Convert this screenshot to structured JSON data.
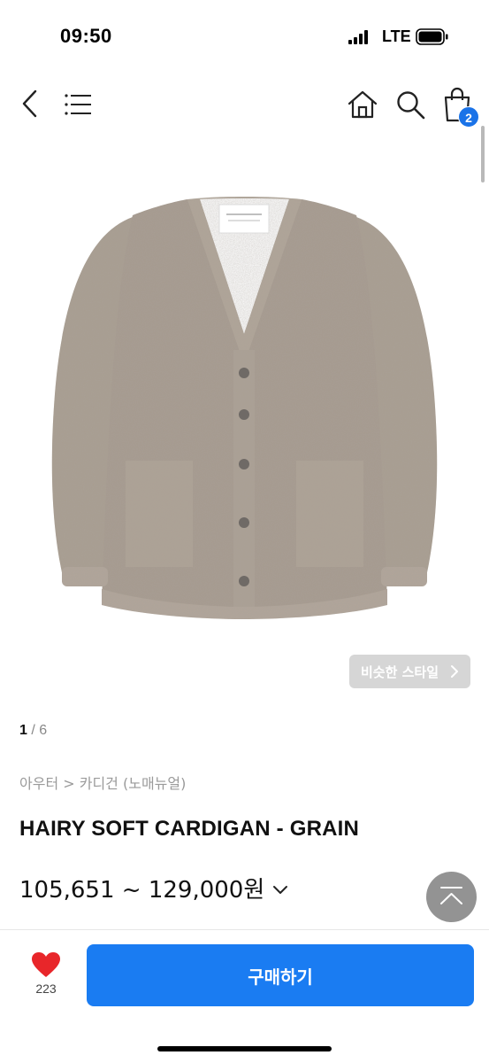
{
  "status_bar": {
    "time": "09:50",
    "network": "LTE"
  },
  "header": {
    "cart_count": "2",
    "icons": [
      "back-icon",
      "menu-icon",
      "home-icon",
      "search-icon",
      "shopping-bag-icon"
    ]
  },
  "product": {
    "image_counter": {
      "current": "1",
      "separator": " / ",
      "total": "6"
    },
    "similar_style_label": "비슷한 스타일",
    "breadcrumb": "아우터 > 카디건 (노매뉴얼)",
    "title": "HAIRY SOFT CARDIGAN - GRAIN",
    "price": "105,651 ~ 129,000원"
  },
  "bottom_bar": {
    "like_count": "223",
    "buy_label": "구매하기"
  },
  "colors": {
    "accent": "#1a7cf2",
    "badge": "#1a73e8",
    "heart": "#e8262a",
    "cardigan": "#a59a8e"
  }
}
